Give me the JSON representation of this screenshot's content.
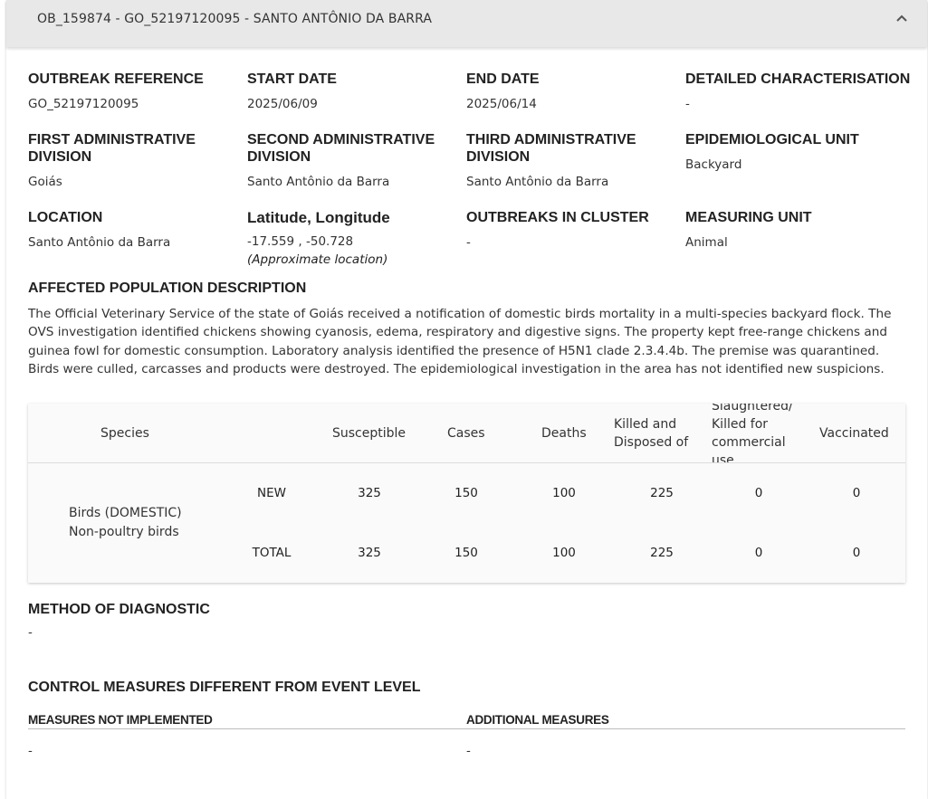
{
  "header": {
    "title": "OB_159874 - GO_52197120095 - SANTO ANTÔNIO DA BARRA",
    "collapse_icon": "chevron-up-icon"
  },
  "fields": {
    "outbreak_reference": {
      "label": "OUTBREAK REFERENCE",
      "value": "GO_52197120095"
    },
    "start_date": {
      "label": "START DATE",
      "value": "2025/06/09"
    },
    "end_date": {
      "label": "END DATE",
      "value": "2025/06/14"
    },
    "detailed_characterisation": {
      "label": "DETAILED CHARACTERISATION",
      "value": "-"
    },
    "first_admin": {
      "label": "FIRST ADMINISTRATIVE DIVISION",
      "value": "Goiás"
    },
    "second_admin": {
      "label": "SECOND ADMINISTRATIVE DIVISION",
      "value": "Santo Antônio da Barra"
    },
    "third_admin": {
      "label": "THIRD ADMINISTRATIVE DIVISION",
      "value": "Santo Antônio da Barra"
    },
    "epidemiological_unit": {
      "label": "EPIDEMIOLOGICAL UNIT",
      "value": "Backyard"
    },
    "location": {
      "label": "LOCATION",
      "value": "Santo Antônio da Barra"
    },
    "lat_long": {
      "label": "Latitude, Longitude",
      "value": "-17.559 , -50.728",
      "note": "(Approximate location)"
    },
    "outbreaks_in_cluster": {
      "label": "OUTBREAKS IN CLUSTER",
      "value": "-"
    },
    "measuring_unit": {
      "label": "MEASURING UNIT",
      "value": "Animal"
    }
  },
  "affected_population": {
    "label": "AFFECTED POPULATION DESCRIPTION",
    "text": "The Official Veterinary Service of the state of Goiás received a notification of domestic birds mortality in a multi-species backyard flock. The OVS investigation identified chickens showing cyanosis, edema, respiratory and digestive signs. The property kept free-range chickens and guinea fowl for domestic consumption. Laboratory analysis identified the presence of H5N1 clade 2.3.4.4b. The premise was quarantined. Birds were culled, carcasses and products were destroyed. The epidemiological investigation in the area has not identified new suspicions."
  },
  "species_table": {
    "columns": {
      "species": "Species",
      "susceptible": "Susceptible",
      "cases": "Cases",
      "deaths": "Deaths",
      "killed": "Killed and Disposed of",
      "slaughtered": "Slaughtered/ Killed for commercial use",
      "vaccinated": "Vaccinated"
    },
    "species_line1": "Birds (DOMESTIC)",
    "species_line2": "Non-poultry birds",
    "rows": [
      {
        "type": "NEW",
        "susceptible": "325",
        "cases": "150",
        "deaths": "100",
        "killed": "225",
        "slaughtered": "0",
        "vaccinated": "0"
      },
      {
        "type": "TOTAL",
        "susceptible": "325",
        "cases": "150",
        "deaths": "100",
        "killed": "225",
        "slaughtered": "0",
        "vaccinated": "0"
      }
    ]
  },
  "diagnostic": {
    "label": "METHOD OF DIAGNOSTIC",
    "value": "-"
  },
  "control_measures": {
    "label": "CONTROL MEASURES DIFFERENT FROM EVENT LEVEL",
    "not_implemented_label": "MEASURES NOT IMPLEMENTED",
    "not_implemented_value": "-",
    "additional_label": "ADDITIONAL MEASURES",
    "additional_value": "-"
  }
}
